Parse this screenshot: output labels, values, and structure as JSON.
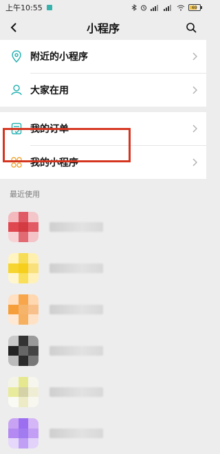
{
  "status": {
    "time": "上午10:55",
    "battery": "69"
  },
  "nav": {
    "title": "小程序"
  },
  "menu": {
    "nearby": "附近的小程序",
    "everyone": "大家在用",
    "orders": "我的订单",
    "mine": "我的小程序"
  },
  "recent": {
    "header": "最近使用"
  },
  "colors": {
    "accent_teal": "#2bb3b3",
    "highlight_red": "#d5351f"
  },
  "icons": {
    "nearby": "location-pin-icon",
    "everyone": "users-icon",
    "orders": "order-list-icon",
    "mine": "mini-programs-icon",
    "back": "back-arrow-icon",
    "search": "search-icon"
  }
}
